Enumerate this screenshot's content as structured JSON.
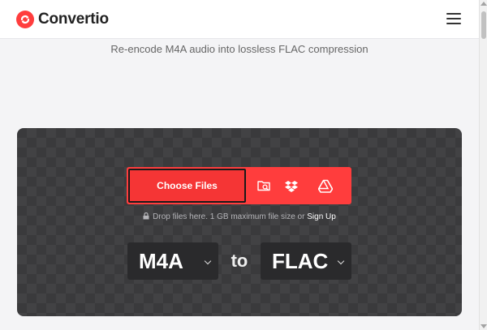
{
  "header": {
    "brand": "Convertio",
    "menu_icon": "hamburger-icon"
  },
  "page": {
    "subtitle": "Re-encode M4A audio into lossless FLAC compression"
  },
  "converter": {
    "choose_label": "Choose Files",
    "sources": [
      {
        "name": "folder-search-icon"
      },
      {
        "name": "dropbox-icon"
      },
      {
        "name": "google-drive-icon"
      }
    ],
    "hint_text": "Drop files here. 1 GB maximum file size or",
    "signup_label": "Sign Up",
    "from_format": "M4A",
    "to_word": "to",
    "to_format": "FLAC"
  },
  "colors": {
    "accent": "#ff3d3d",
    "panel": "#3a3a3c",
    "select_bg": "#2a2a2c"
  }
}
